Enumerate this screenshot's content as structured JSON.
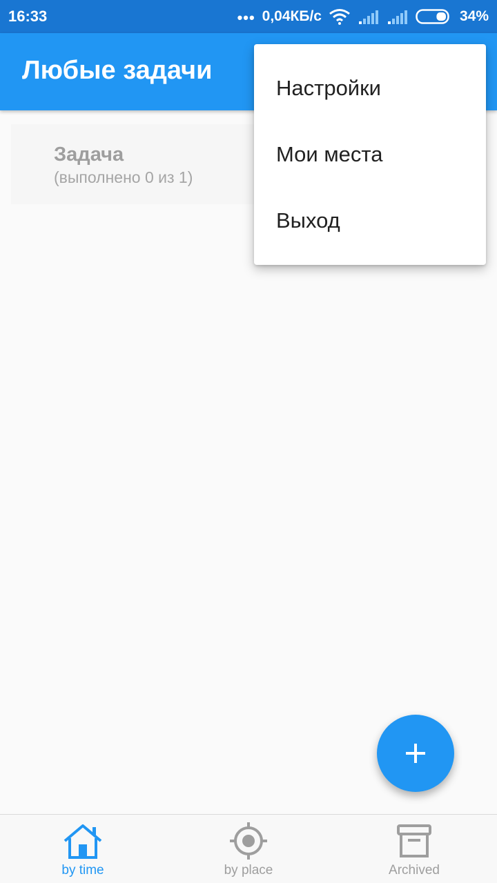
{
  "status_bar": {
    "time": "16:33",
    "more_indicator": "•••",
    "network_speed": "0,04КБ/с",
    "battery_percent": "34%",
    "battery_level": 0.34,
    "icons": [
      "wifi-icon",
      "signal-icon",
      "signal-icon",
      "battery-icon"
    ]
  },
  "app_bar": {
    "title": "Любые задачи",
    "color": "#2196f3"
  },
  "tasks": [
    {
      "title": "Задача",
      "subtitle": "(выполнено 0 из 1)"
    }
  ],
  "overflow_menu": {
    "items": [
      {
        "label": "Настройки"
      },
      {
        "label": "Мои места"
      },
      {
        "label": "Выход"
      }
    ]
  },
  "fab": {
    "icon": "plus-icon",
    "color": "#2196f3"
  },
  "bottom_nav": {
    "items": [
      {
        "label": "by time",
        "icon": "home-icon",
        "active": true
      },
      {
        "label": "by place",
        "icon": "target-icon",
        "active": false
      },
      {
        "label": "Archived",
        "icon": "archive-icon",
        "active": false
      }
    ],
    "active_color": "#2196f3",
    "inactive_color": "#9e9e9e"
  }
}
